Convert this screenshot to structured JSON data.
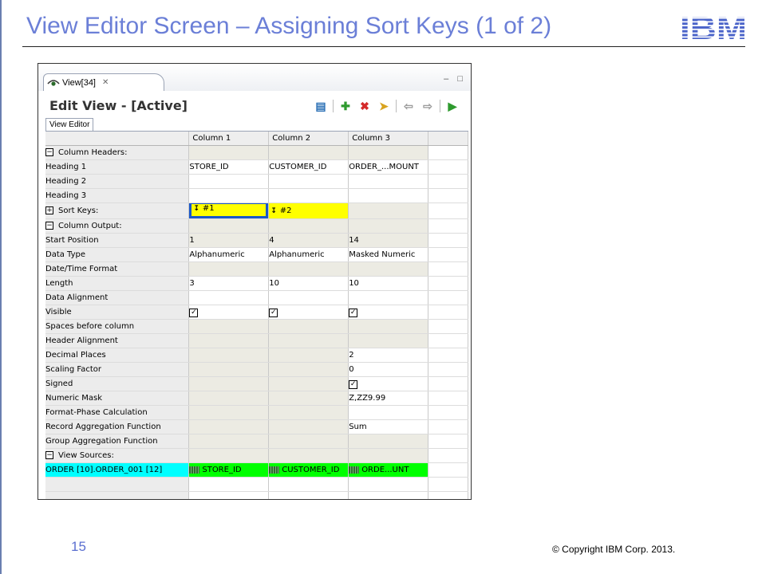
{
  "slide": {
    "title": "View Editor Screen – Assigning Sort Keys (1 of 2)",
    "logo_text": "IBM",
    "number": "15",
    "copyright": "© Copyright  IBM Corp. 2013."
  },
  "window": {
    "tab_label": "View[34]",
    "tab_close": "✕",
    "controls": "– □",
    "editor_title": "Edit View - [Active]",
    "editor_tab": "View Editor"
  },
  "toolbar": {
    "icons": [
      "refresh-view-icon",
      "add-icon",
      "delete-icon",
      "paste-icon",
      "move-left-icon",
      "move-right-icon",
      "activate-icon"
    ]
  },
  "grid": {
    "columns": [
      "Column 1",
      "Column 2",
      "Column 3"
    ],
    "rows": {
      "column_headers": "Column Headers:",
      "heading1": {
        "label": "Heading 1",
        "values": [
          "STORE_ID",
          "CUSTOMER_ID",
          "ORDER_...MOUNT"
        ]
      },
      "heading2": {
        "label": "Heading 2"
      },
      "heading3": {
        "label": "Heading 3"
      },
      "sort_keys": {
        "label": "Sort Keys:",
        "values": [
          "#1",
          "#2",
          ""
        ]
      },
      "column_output": "Column Output:",
      "start_position": {
        "label": "Start Position",
        "values": [
          "1",
          "4",
          "14"
        ]
      },
      "data_type": {
        "label": "Data Type",
        "values": [
          "Alphanumeric",
          "Alphanumeric",
          "Masked Numeric"
        ]
      },
      "date_time_format": {
        "label": "Date/Time Format"
      },
      "length": {
        "label": "Length",
        "values": [
          "3",
          "10",
          "10"
        ]
      },
      "data_alignment": {
        "label": "Data Alignment"
      },
      "visible": {
        "label": "Visible",
        "checked": [
          true,
          true,
          true
        ]
      },
      "spaces_before": {
        "label": "Spaces before column"
      },
      "header_alignment": {
        "label": "Header Alignment"
      },
      "decimal_places": {
        "label": "Decimal Places",
        "values": [
          "",
          "",
          "2"
        ]
      },
      "scaling_factor": {
        "label": "Scaling Factor",
        "values": [
          "",
          "",
          "0"
        ]
      },
      "signed": {
        "label": "Signed",
        "checked": [
          false,
          false,
          true
        ]
      },
      "numeric_mask": {
        "label": "Numeric Mask",
        "values": [
          "",
          "",
          "Z,ZZ9.99"
        ]
      },
      "format_phase_calc": {
        "label": "Format-Phase Calculation"
      },
      "record_aggregation": {
        "label": "Record Aggregation Function",
        "values": [
          "",
          "",
          "Sum"
        ]
      },
      "group_aggregation": {
        "label": "Group Aggregation Function"
      },
      "view_sources": "View Sources:",
      "source": {
        "label": "ORDER [10].ORDER_001 [12]",
        "values": [
          "STORE_ID",
          "CUSTOMER_ID",
          "ORDE...UNT"
        ]
      }
    },
    "colors": {
      "sort_key": "#ffff00",
      "source_label": "#00ffff",
      "source_field": "#00ff00",
      "selection": "#1b58c9"
    }
  }
}
